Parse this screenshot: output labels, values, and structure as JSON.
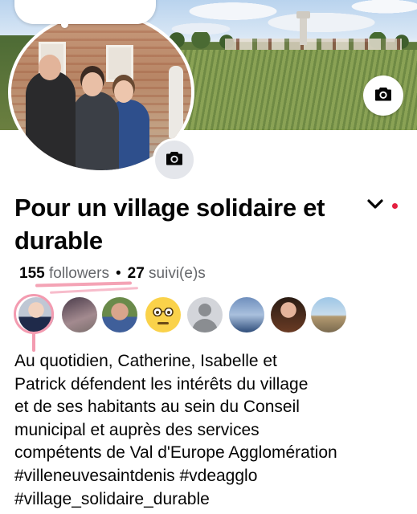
{
  "page": {
    "name": "Pour un village solidaire et durable",
    "followers_count": "155",
    "followers_label": "followers",
    "following_count": "27",
    "following_label": "suivi(e)s",
    "separator": "•"
  },
  "icons": {
    "cover_camera": "camera-icon",
    "profile_camera": "camera-icon",
    "more": "chevron-down-icon"
  },
  "colors": {
    "notification_dot": "#e41e3f",
    "highlight_annotation": "#f39bb0",
    "secondary_text": "#65676b"
  },
  "followers_preview": [
    {
      "name": "follower-avatar-1"
    },
    {
      "name": "follower-avatar-2"
    },
    {
      "name": "follower-avatar-3"
    },
    {
      "name": "follower-avatar-4"
    },
    {
      "name": "follower-avatar-5"
    },
    {
      "name": "follower-avatar-6"
    },
    {
      "name": "follower-avatar-7"
    },
    {
      "name": "follower-avatar-8"
    }
  ],
  "bio": "Au quotidien, Catherine, Isabelle et\nPatrick défendent les intérêts du village\net de ses habitants au sein du Conseil\nmunicipal et auprès des services\ncompétents de Val d'Europe Agglomération\n#villeneuvesaintdenis #vdeagglo\n#village_solidaire_durable"
}
